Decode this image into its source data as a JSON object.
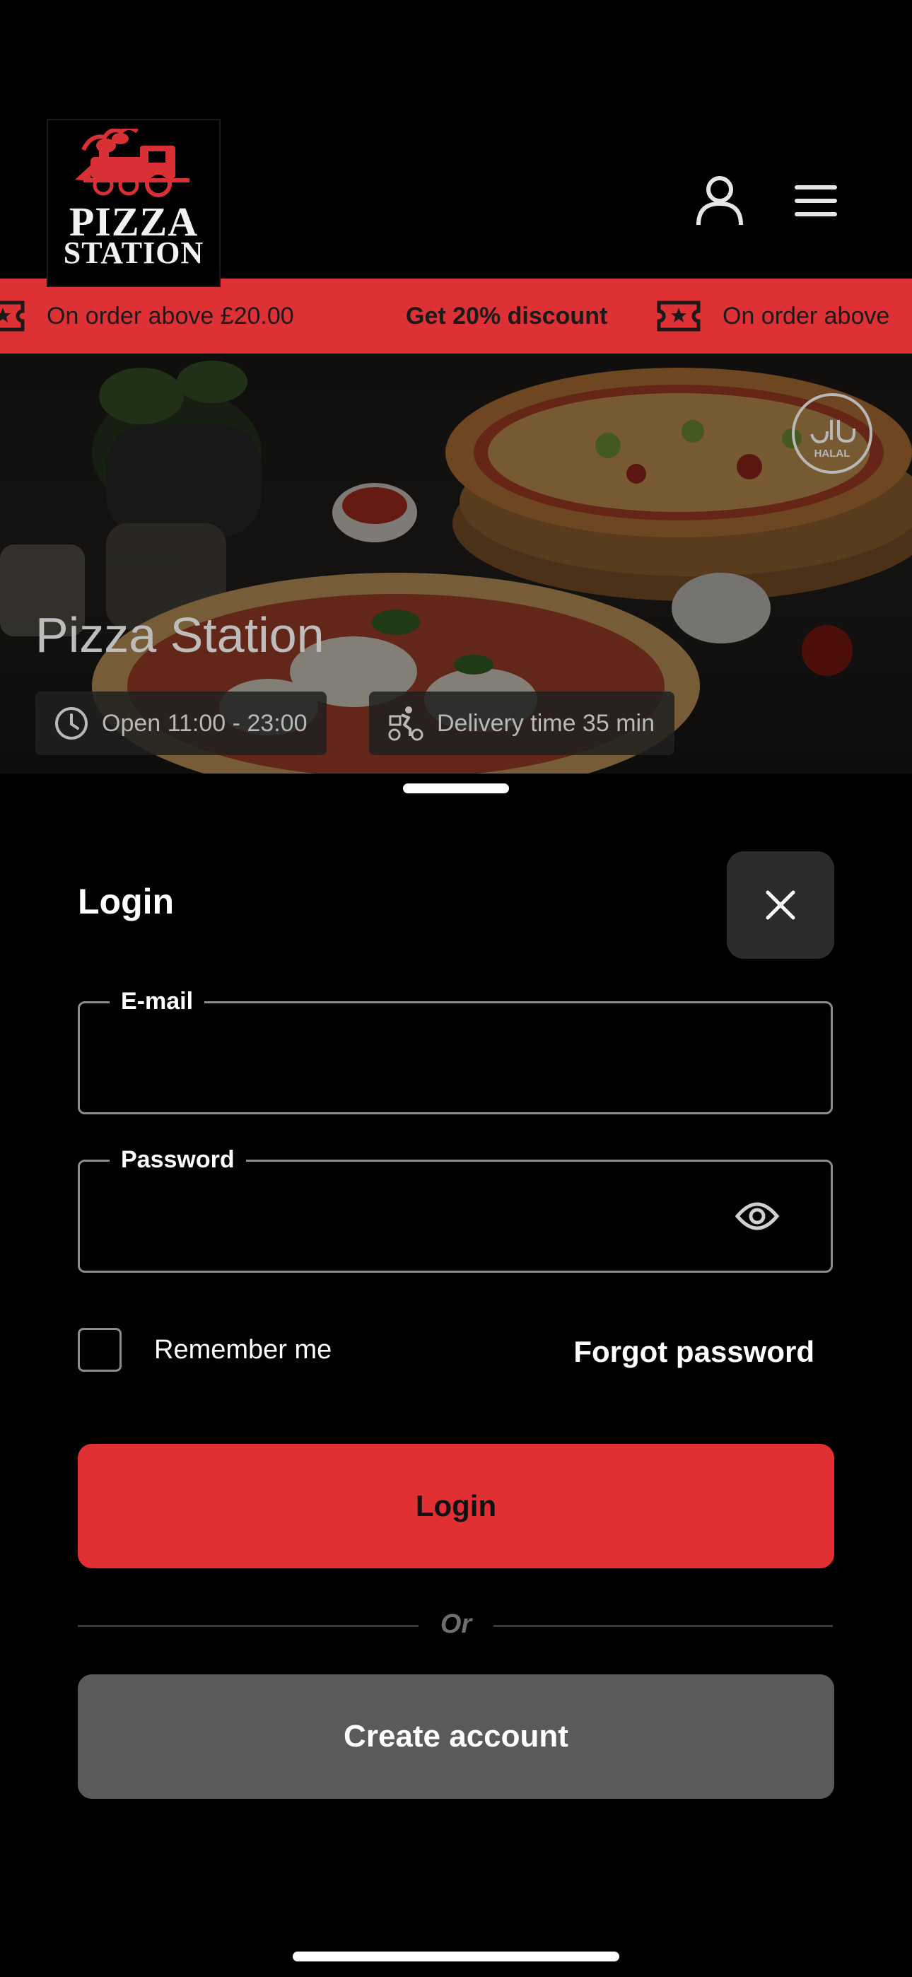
{
  "brand": {
    "logo_line1": "PIZZA",
    "logo_line2": "STATION",
    "logo_icon": "train-icon",
    "accent_color": "#dd3135"
  },
  "header": {
    "account_icon": "user-icon",
    "menu_icon": "hamburger-menu-icon"
  },
  "promo": {
    "items": [
      {
        "text": "On order above £20.00",
        "bold": false
      },
      {
        "text": "Get 20% discount",
        "bold": true
      },
      {
        "text": "On order above",
        "bold": false
      }
    ],
    "icon": "ticket-star-icon"
  },
  "restaurant": {
    "name": "Pizza Station",
    "hours": "Open 11:00 - 23:00",
    "delivery": "Delivery time 35 min",
    "halal_label": "HALAL"
  },
  "login": {
    "title": "Login",
    "email_label": "E-mail",
    "email_value": "",
    "password_label": "Password",
    "password_value": "",
    "remember_label": "Remember me",
    "remember_checked": false,
    "forgot_label": "Forgot password",
    "login_button": "Login",
    "or_label": "Or",
    "create_button": "Create account"
  }
}
